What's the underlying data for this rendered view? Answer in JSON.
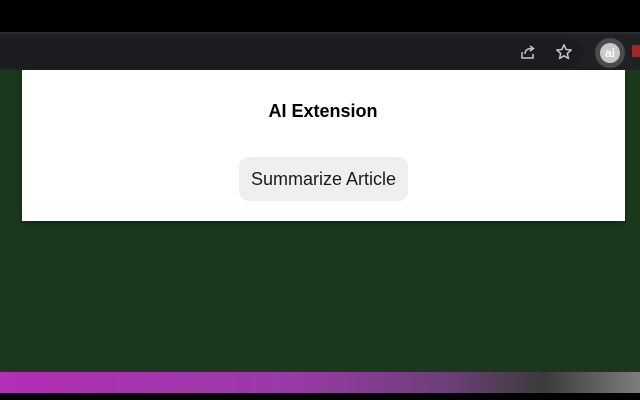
{
  "browser": {
    "toolbar_icons": [
      "share-icon",
      "star-icon"
    ],
    "extension": {
      "icon": "ai-extension-icon",
      "badge_text": "ai"
    }
  },
  "popup": {
    "title": "AI Extension",
    "button_label": "Summarize Article"
  },
  "colors": {
    "page_background": "#1b381c",
    "toolbar_background": "#202124",
    "popup_background": "#ffffff",
    "button_background": "#efefef",
    "bottom_strip_accent": "#b22fb6"
  }
}
